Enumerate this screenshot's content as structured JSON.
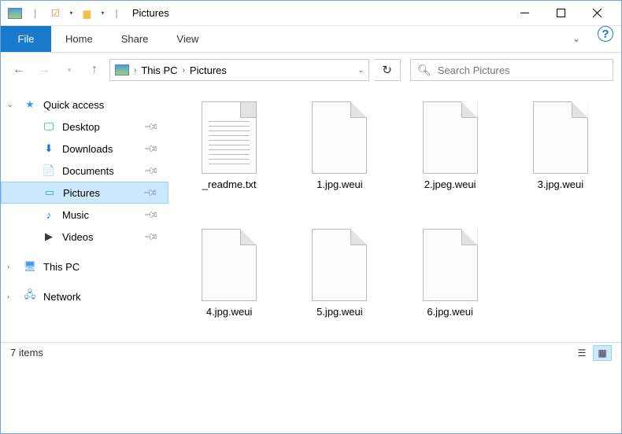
{
  "titlebar": {
    "title": "Pictures"
  },
  "ribbon": {
    "file": "File",
    "tabs": [
      "Home",
      "Share",
      "View"
    ]
  },
  "breadcrumb": {
    "items": [
      "This PC",
      "Pictures"
    ]
  },
  "search": {
    "placeholder": "Search Pictures"
  },
  "nav": {
    "quick_access": "Quick access",
    "items": [
      {
        "label": "Desktop",
        "icon": "desktop",
        "color": "#0a78d4"
      },
      {
        "label": "Downloads",
        "icon": "downloads",
        "color": "#0a78d4"
      },
      {
        "label": "Documents",
        "icon": "documents",
        "color": "#4096d0"
      },
      {
        "label": "Pictures",
        "icon": "pictures",
        "color": "#3aa0d8",
        "selected": true
      },
      {
        "label": "Music",
        "icon": "music",
        "color": "#1b74c3"
      },
      {
        "label": "Videos",
        "icon": "videos",
        "color": "#3a3a3a"
      }
    ],
    "this_pc": "This PC",
    "network": "Network"
  },
  "files": [
    {
      "name": "_readme.txt",
      "type": "txt"
    },
    {
      "name": "1.jpg.weui",
      "type": "blank"
    },
    {
      "name": "2.jpeg.weui",
      "type": "blank"
    },
    {
      "name": "3.jpg.weui",
      "type": "blank"
    },
    {
      "name": "4.jpg.weui",
      "type": "blank"
    },
    {
      "name": "5.jpg.weui",
      "type": "blank"
    },
    {
      "name": "6.jpg.weui",
      "type": "blank"
    }
  ],
  "status": {
    "count": "7 items"
  }
}
